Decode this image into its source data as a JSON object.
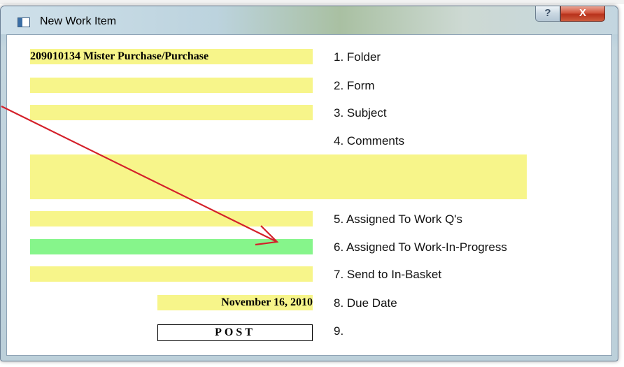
{
  "window": {
    "title": "New Work Item",
    "help_label": "?",
    "close_label": "X"
  },
  "form": {
    "folder_value": "209010134 Mister Purchase/Purchase",
    "due_date_value": "November 16, 2010",
    "post_label": "POST",
    "labels": {
      "folder": "1. Folder",
      "form": "2. Form",
      "subject": "3. Subject",
      "comments": "4. Comments",
      "assigned_work_q": "5. Assigned To Work Q's",
      "assigned_wip": "6. Assigned To Work-In-Progress",
      "send_inbasket": "7. Send to In-Basket",
      "due_date": "8. Due Date",
      "post": "9."
    }
  },
  "colors": {
    "field_yellow": "#f7f58a",
    "field_green": "#86f58b",
    "annotation_arrow": "#d4202a"
  }
}
